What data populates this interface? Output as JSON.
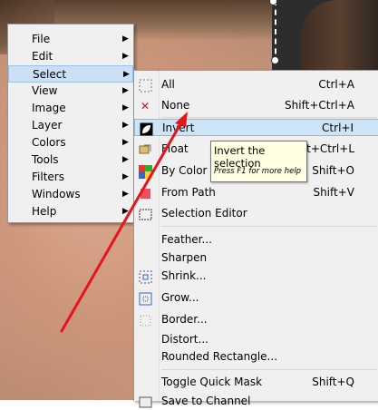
{
  "main_menu": {
    "items": [
      {
        "label": "File",
        "mnemonic": "F"
      },
      {
        "label": "Edit",
        "mnemonic": "E"
      },
      {
        "label": "Select",
        "mnemonic": "S",
        "active": true
      },
      {
        "label": "View",
        "mnemonic": "V"
      },
      {
        "label": "Image",
        "mnemonic": "I"
      },
      {
        "label": "Layer",
        "mnemonic": "L"
      },
      {
        "label": "Colors",
        "mnemonic": "C"
      },
      {
        "label": "Tools",
        "mnemonic": "T"
      },
      {
        "label": "Filters",
        "mnemonic": "r"
      },
      {
        "label": "Windows",
        "mnemonic": "W"
      },
      {
        "label": "Help",
        "mnemonic": "H"
      }
    ],
    "arrow_glyph": "▶"
  },
  "select_menu": {
    "items": [
      {
        "label": "All",
        "shortcut": "Ctrl+A",
        "icon": "select-all-icon"
      },
      {
        "label": "None",
        "shortcut": "Shift+Ctrl+A",
        "icon": "select-none-icon"
      },
      {
        "label": "Invert",
        "shortcut": "Ctrl+I",
        "icon": "invert-icon",
        "highlighted": true
      },
      {
        "label": "Float",
        "shortcut": "Shift+Ctrl+L",
        "icon": "float-icon"
      },
      {
        "label": "By Color",
        "shortcut": "Shift+O",
        "icon": "by-color-icon"
      },
      {
        "label": "From Path",
        "shortcut": "Shift+V",
        "icon": "from-path-icon"
      },
      {
        "label": "Selection Editor",
        "shortcut": "",
        "icon": "selection-editor-icon"
      },
      {
        "label": "Feather...",
        "shortcut": "",
        "icon": ""
      },
      {
        "label": "Sharpen",
        "shortcut": "",
        "icon": ""
      },
      {
        "label": "Shrink...",
        "shortcut": "",
        "icon": "shrink-icon"
      },
      {
        "label": "Grow...",
        "shortcut": "",
        "icon": "grow-icon"
      },
      {
        "label": "Border...",
        "shortcut": "",
        "icon": "border-icon"
      },
      {
        "label": "Distort...",
        "shortcut": "",
        "icon": ""
      },
      {
        "label": "Rounded Rectangle...",
        "shortcut": "",
        "icon": ""
      },
      {
        "label": "Toggle Quick Mask",
        "shortcut": "Shift+Q",
        "icon": ""
      },
      {
        "label": "Save to Channel",
        "shortcut": "",
        "icon": "save-channel-icon"
      }
    ]
  },
  "tooltip": {
    "text": "Invert the selection",
    "help": "Press F1 for more help"
  },
  "colors": {
    "annotation_arrow": "#e8141b",
    "menu_bg": "#f0f0f0",
    "highlight": "#cde4f7",
    "tooltip_bg": "#ffffe1"
  }
}
